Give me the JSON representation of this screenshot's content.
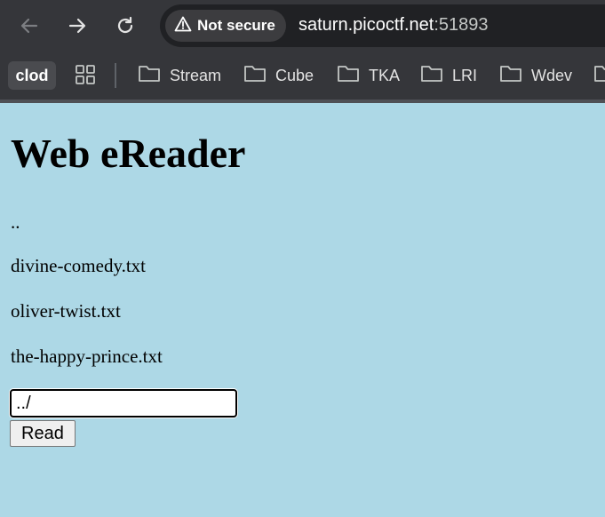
{
  "browser": {
    "url_host": "saturn.picoctf.net",
    "url_port": ":51893",
    "security_label": "Not secure",
    "icons": {
      "back": "arrow-left-icon",
      "forward": "arrow-right-icon",
      "reload": "reload-icon",
      "security": "warning-triangle-icon",
      "apps": "grid-apps-icon",
      "folder": "folder-icon"
    }
  },
  "bookmarks": {
    "profile_label": "clod",
    "items": [
      {
        "label": "Stream"
      },
      {
        "label": "Cube"
      },
      {
        "label": "TKA"
      },
      {
        "label": "LRI"
      },
      {
        "label": "Wdev"
      }
    ]
  },
  "page": {
    "title": "Web eReader",
    "files": [
      {
        "label": ".."
      },
      {
        "label": "divine-comedy.txt"
      },
      {
        "label": "oliver-twist.txt"
      },
      {
        "label": "the-happy-prince.txt"
      }
    ],
    "input_value": "../",
    "read_label": "Read"
  },
  "colors": {
    "page_background": "#add8e6",
    "chrome_background": "#35363a",
    "omnibox_background": "#202124"
  }
}
